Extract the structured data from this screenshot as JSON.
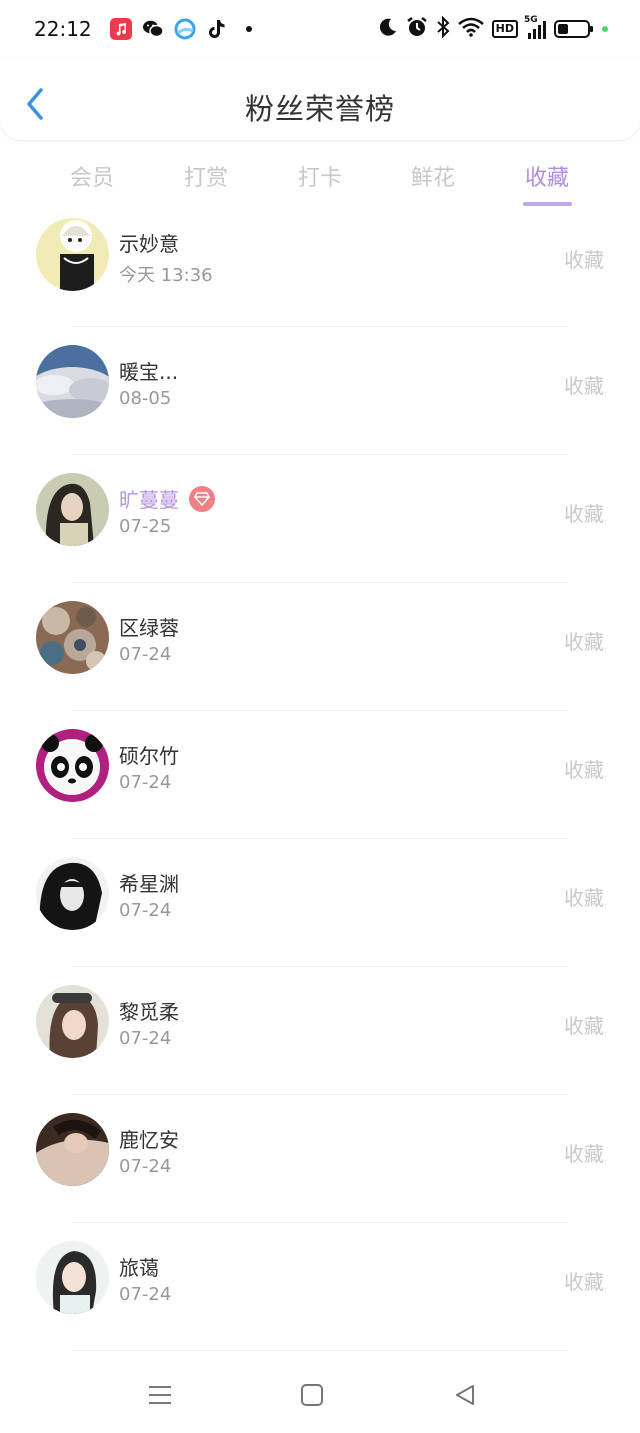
{
  "status_bar": {
    "time": "22:12",
    "apps": [
      {
        "icon": "music-app-icon",
        "color": "#ea3b4d"
      },
      {
        "icon": "wechat-icon",
        "color": "#111111"
      },
      {
        "icon": "browser-icon",
        "color": "#3aa4f0"
      },
      {
        "icon": "tiktok-icon",
        "color": "#111111"
      }
    ],
    "hd_label": "HD",
    "network_label": "5G",
    "battery_level": 0.35
  },
  "header": {
    "title": "粉丝荣誉榜"
  },
  "tabs": [
    {
      "label": "会员",
      "active": false
    },
    {
      "label": "打赏",
      "active": false
    },
    {
      "label": "打卡",
      "active": false
    },
    {
      "label": "鲜花",
      "active": false
    },
    {
      "label": "收藏",
      "active": true
    }
  ],
  "list": [
    {
      "name": "示妙意",
      "date": "今天 13:36",
      "action": "收藏",
      "vip": false
    },
    {
      "name": "暖宝...",
      "date": "08-05",
      "action": "收藏",
      "vip": false
    },
    {
      "name": "旷蔓蔓",
      "date": "07-25",
      "action": "收藏",
      "vip": true
    },
    {
      "name": "区绿蓉",
      "date": "07-24",
      "action": "收藏",
      "vip": false
    },
    {
      "name": "硕尔竹",
      "date": "07-24",
      "action": "收藏",
      "vip": false
    },
    {
      "name": "希星渊",
      "date": "07-24",
      "action": "收藏",
      "vip": false
    },
    {
      "name": "黎觅柔",
      "date": "07-24",
      "action": "收藏",
      "vip": false
    },
    {
      "name": "鹿忆安",
      "date": "07-24",
      "action": "收藏",
      "vip": false
    },
    {
      "name": "旅蔼",
      "date": "07-24",
      "action": "收藏",
      "vip": false
    }
  ],
  "colors": {
    "accent": "#b28fde",
    "back_arrow": "#3a93e0",
    "vip_badge": "#f07f86"
  }
}
